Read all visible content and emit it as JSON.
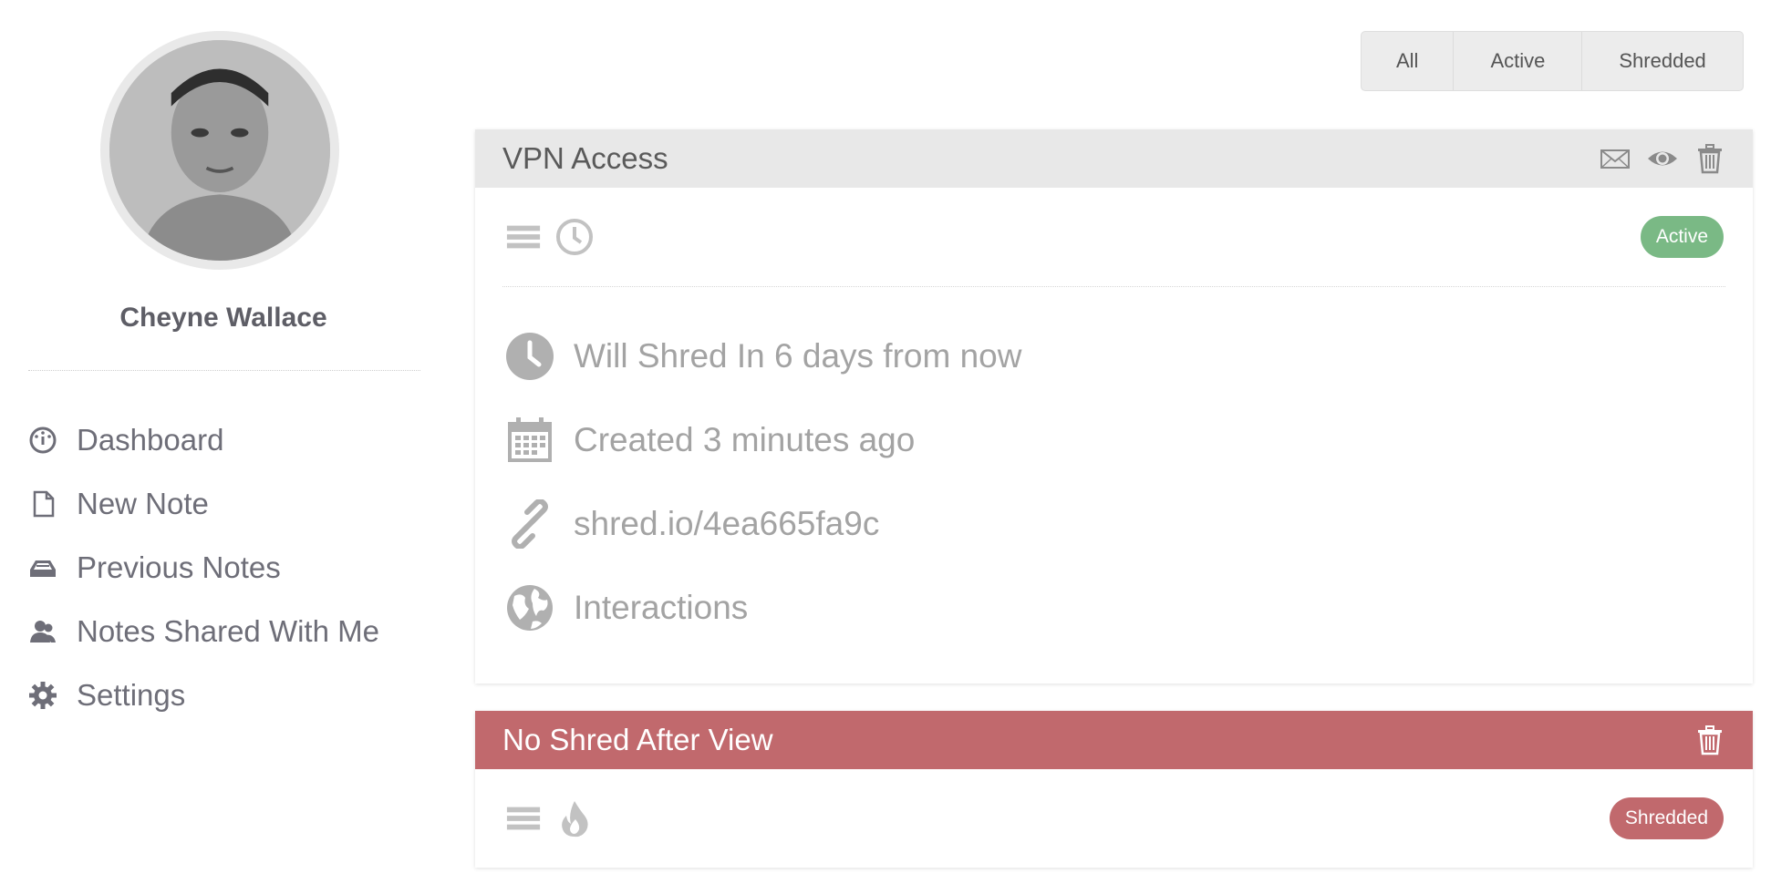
{
  "profile": {
    "name": "Cheyne Wallace"
  },
  "nav": [
    {
      "label": "Dashboard",
      "icon": "dashboard-icon"
    },
    {
      "label": "New Note",
      "icon": "file-icon"
    },
    {
      "label": "Previous Notes",
      "icon": "inbox-icon"
    },
    {
      "label": "Notes Shared With Me",
      "icon": "user-shared-icon"
    },
    {
      "label": "Settings",
      "icon": "gear-icon"
    }
  ],
  "filters": [
    "All",
    "Active",
    "Shredded"
  ],
  "notes": [
    {
      "title": "VPN Access",
      "status": "Active",
      "header_icons": [
        "envelope-icon",
        "eye-icon",
        "trash-icon"
      ],
      "row_icons": [
        "list-icon",
        "clock-icon"
      ],
      "details": [
        {
          "icon": "clock-icon",
          "text": "Will Shred In 6 days from now"
        },
        {
          "icon": "calendar-icon",
          "text": "Created 3 minutes ago"
        },
        {
          "icon": "link-icon",
          "text": "shred.io/4ea665fa9c"
        },
        {
          "icon": "globe-icon",
          "text": "Interactions"
        }
      ]
    },
    {
      "title": "No Shred After View",
      "status": "Shredded",
      "header_icons": [
        "trash-icon"
      ],
      "row_icons": [
        "list-icon",
        "fire-icon"
      ]
    }
  ],
  "colors": {
    "active": "#7ab985",
    "shredded": "#c1696d",
    "header_gray": "#e8e8e8"
  }
}
